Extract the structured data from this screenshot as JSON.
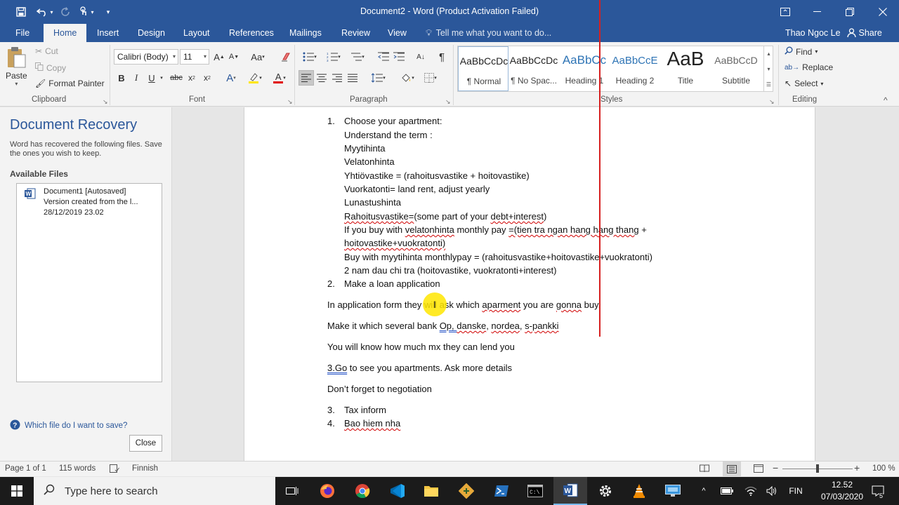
{
  "window": {
    "title": "Document2 - Word (Product Activation Failed)"
  },
  "tabs": [
    {
      "label": "File"
    },
    {
      "label": "Home"
    },
    {
      "label": "Insert"
    },
    {
      "label": "Design"
    },
    {
      "label": "Layout"
    },
    {
      "label": "References"
    },
    {
      "label": "Mailings"
    },
    {
      "label": "Review"
    },
    {
      "label": "View"
    }
  ],
  "tell_me": "Tell me what you want to do...",
  "user_name": "Thao Ngoc Le",
  "share_label": "Share",
  "clipboard": {
    "paste": "Paste",
    "cut": "Cut",
    "copy": "Copy",
    "format_painter": "Format Painter",
    "group": "Clipboard"
  },
  "font": {
    "family": "Calibri (Body)",
    "size": "11",
    "group": "Font"
  },
  "paragraph": {
    "group": "Paragraph"
  },
  "styles": {
    "group": "Styles",
    "items": [
      {
        "preview": "AaBbCcDc",
        "name": "¶ Normal"
      },
      {
        "preview": "AaBbCcDc",
        "name": "¶ No Spac..."
      },
      {
        "preview": "AaBbCc",
        "name": "Heading 1"
      },
      {
        "preview": "AaBbCcE",
        "name": "Heading 2"
      },
      {
        "preview": "AaB",
        "name": "Title"
      },
      {
        "preview": "AaBbCcD",
        "name": "Subtitle"
      }
    ]
  },
  "editing": {
    "find": "Find",
    "replace": "Replace",
    "select": "Select",
    "group": "Editing"
  },
  "recovery": {
    "title": "Document Recovery",
    "description": "Word has recovered the following files. Save the ones you wish to keep.",
    "available": "Available Files",
    "file_name": "Document1  [Autosaved]",
    "file_version": "Version created from the l...",
    "file_date": "28/12/2019 23.02",
    "help": "Which file do I want to save?",
    "close": "Close"
  },
  "document": {
    "n1": "1.",
    "l1": "Choose your apartment:",
    "l2": "Understand the term :",
    "l3": "Myytihinta",
    "l4": "Velatonhinta",
    "l5": "Yhtiövastike = (rahoitusvastike + hoitovastike)",
    "l6": "Vuorkatonti= land rent, adjust yearly",
    "l7": "Lunastushinta",
    "l8a": "Rahoitusvastike=",
    "l8b": "(some part of your ",
    "l8c": "debt+interest",
    "l8d": ")",
    "l9a": "If you buy with ",
    "l9b": "velatonhinta",
    "l9c": " monthly pay ",
    "l9d": "=(tien tra ngan hang hang thang",
    "l9e": " +",
    "l10": "hoitovastike+vuokratonti)",
    "l11": "Buy with myytihinta monthlypay = (rahoitusvastike+hoitovastike+vuokratonti)",
    "l12": "2 nam dau chi tra (hoitovastike, vuokratonti+interest)",
    "n2": "2.",
    "l13": "Make a loan application",
    "p1a": "In application form they will ask which ",
    "p1b": "aparment",
    "p1c": " you are ",
    "p1d": "gonna",
    "p1e": " buy.",
    "p2a": "Make it which several bank ",
    "p2b": "Op",
    "p2c": ", ",
    "p2d": "danske",
    "p2e": ", ",
    "p2f": "nordea",
    "p2g": ", ",
    "p2h": "s-pankki",
    "p3": "You will know how much mx they can lend you",
    "p4a": "3.Go",
    "p4b": " to see you apartments. Ask more details",
    "p5": "Don’t forget to negotiation",
    "n3": "3.",
    "l14": "Tax inform",
    "n4": "4.",
    "l15": "Bao hiem nha"
  },
  "status": {
    "page": "Page 1 of 1",
    "words": "115 words",
    "language": "Finnish",
    "zoom": "100 %"
  },
  "taskbar": {
    "search_placeholder": "Type here to search",
    "lang": "FIN",
    "time": "12.52",
    "date": "07/03/2020",
    "notifications": "5"
  },
  "colors": {
    "accent": "#2b579a",
    "spelling": "#d00000",
    "grammar": "#2b57c8"
  }
}
